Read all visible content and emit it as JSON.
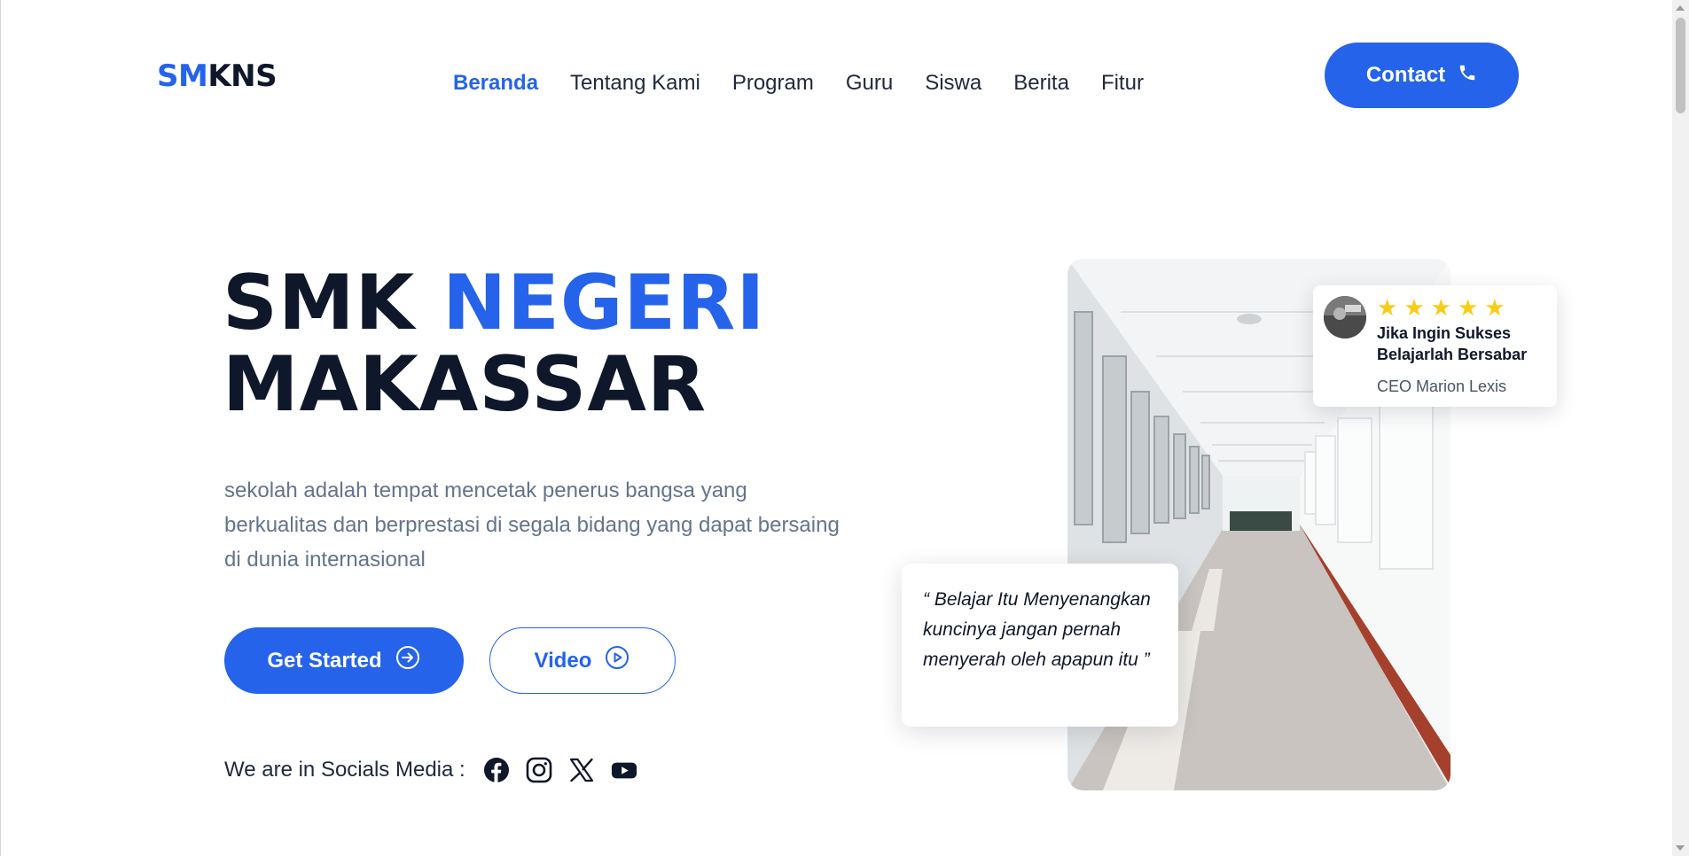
{
  "header": {
    "logo_part1": "SM",
    "logo_part2": "KNS",
    "nav": [
      {
        "label": "Beranda",
        "active": true
      },
      {
        "label": "Tentang Kami"
      },
      {
        "label": "Program"
      },
      {
        "label": "Guru"
      },
      {
        "label": "Siswa"
      },
      {
        "label": "Berita"
      },
      {
        "label": "Fitur"
      }
    ],
    "contact_label": "Contact",
    "contact_icon": "phone-icon"
  },
  "hero": {
    "title_part1": "SMK ",
    "title_part2": "NEGERI",
    "title_line2": "MAKASSAR",
    "description": "sekolah adalah tempat mencetak penerus bangsa yang berkualitas dan berprestasi di segala bidang yang dapat bersaing di dunia internasional",
    "primary_button": "Get Started",
    "primary_icon": "arrow-right-circle-icon",
    "secondary_button": "Video",
    "secondary_icon": "play-circle-icon",
    "socials_label": "We are in Socials Media :",
    "socials": [
      "facebook-icon",
      "instagram-icon",
      "x-icon",
      "youtube-icon"
    ]
  },
  "review": {
    "stars": 5,
    "text": "Jika Ingin Sukses Belajarlah Bersabar",
    "author": "CEO Marion Lexis"
  },
  "quote": {
    "text": "“ Belajar Itu Menyenangkan kuncinya jangan pernah menyerah oleh apapun itu ”"
  },
  "colors": {
    "accent": "#2563eb",
    "dark": "#0f172a",
    "muted": "#64748b",
    "star": "#facc15"
  }
}
